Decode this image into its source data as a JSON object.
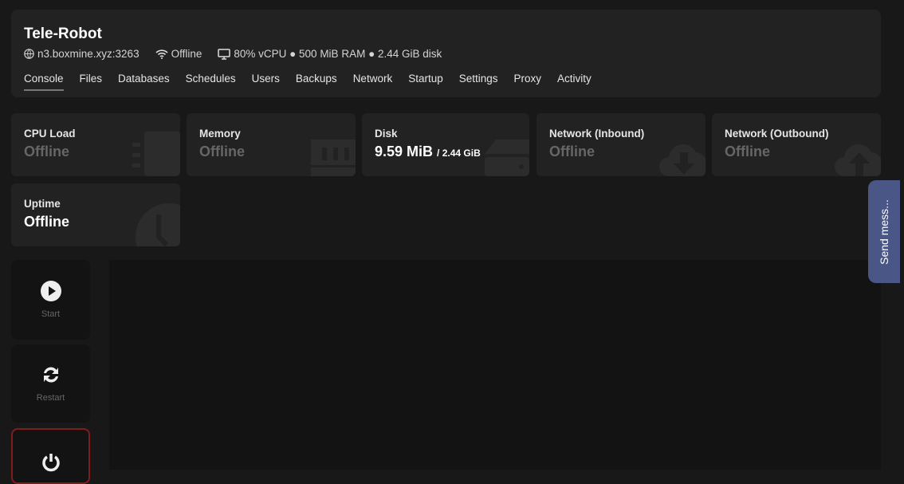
{
  "server": {
    "name": "Tele-Robot",
    "address": "n3.boxmine.xyz:3263",
    "status": "Offline",
    "resources": "80% vCPU ● 500 MiB RAM ● 2.44 GiB disk"
  },
  "tabs": [
    "Console",
    "Files",
    "Databases",
    "Schedules",
    "Users",
    "Backups",
    "Network",
    "Startup",
    "Settings",
    "Proxy",
    "Activity"
  ],
  "stats": {
    "cpu": {
      "label": "CPU Load",
      "value": "Offline"
    },
    "memory": {
      "label": "Memory",
      "value": "Offline"
    },
    "disk": {
      "label": "Disk",
      "value": "9.59 MiB",
      "limit": "/ 2.44 GiB"
    },
    "net_in": {
      "label": "Network (Inbound)",
      "value": "Offline"
    },
    "net_out": {
      "label": "Network (Outbound)",
      "value": "Offline"
    },
    "uptime": {
      "label": "Uptime",
      "value": "Offline"
    }
  },
  "controls": {
    "start": "Start",
    "restart": "Restart",
    "stop_color": "#7f1d1d"
  },
  "feedback": {
    "label": "Send mess..."
  }
}
